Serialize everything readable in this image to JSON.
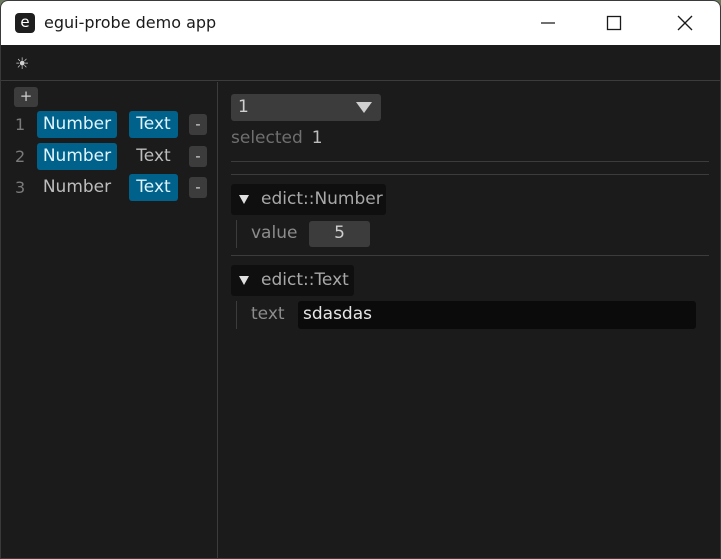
{
  "window": {
    "title": "egui-probe demo app",
    "app_icon_letter": "e"
  },
  "menubar": {
    "theme_icon": "sun-icon",
    "theme_glyph": "☀"
  },
  "list": {
    "add_label": "+",
    "remove_label": "-",
    "rows": [
      {
        "index": "1",
        "number_label": "Number",
        "text_label": "Text",
        "selected": "both"
      },
      {
        "index": "2",
        "number_label": "Number",
        "text_label": "Text",
        "selected": "number"
      },
      {
        "index": "3",
        "number_label": "Number",
        "text_label": "Text",
        "selected": "text"
      }
    ]
  },
  "detail": {
    "combo_value": "1",
    "selected_label": "selected",
    "selected_value": "1",
    "number_section": {
      "header": "edict::Number",
      "field_label": "value",
      "field_value": "5"
    },
    "text_section": {
      "header": "edict::Text",
      "field_label": "text",
      "field_value": "sdasdas"
    }
  },
  "colors": {
    "selected_chip": "#00628a",
    "panel_bg": "#1b1b1b",
    "widget_bg": "#3c3c3c"
  }
}
